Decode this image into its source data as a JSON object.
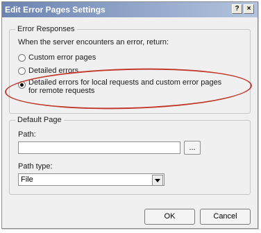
{
  "window": {
    "title": "Edit Error Pages Settings",
    "help_label": "?",
    "close_label": "×"
  },
  "error_responses": {
    "legend": "Error Responses",
    "prompt": "When the server encounters an error, return:",
    "options": [
      {
        "label": "Custom error pages",
        "selected": false
      },
      {
        "label": "Detailed errors",
        "selected": false
      },
      {
        "label": "Detailed errors for local requests and custom error pages",
        "label_line2": "for remote requests",
        "selected": true
      }
    ]
  },
  "default_page": {
    "legend": "Default Page",
    "path_label": "Path:",
    "path_value": "",
    "browse_label": "...",
    "path_type_label": "Path type:",
    "path_type_value": "File"
  },
  "buttons": {
    "ok": "OK",
    "cancel": "Cancel"
  },
  "colors": {
    "title_bar": "#6c84b1",
    "highlight_ellipse": "#c0392b"
  }
}
